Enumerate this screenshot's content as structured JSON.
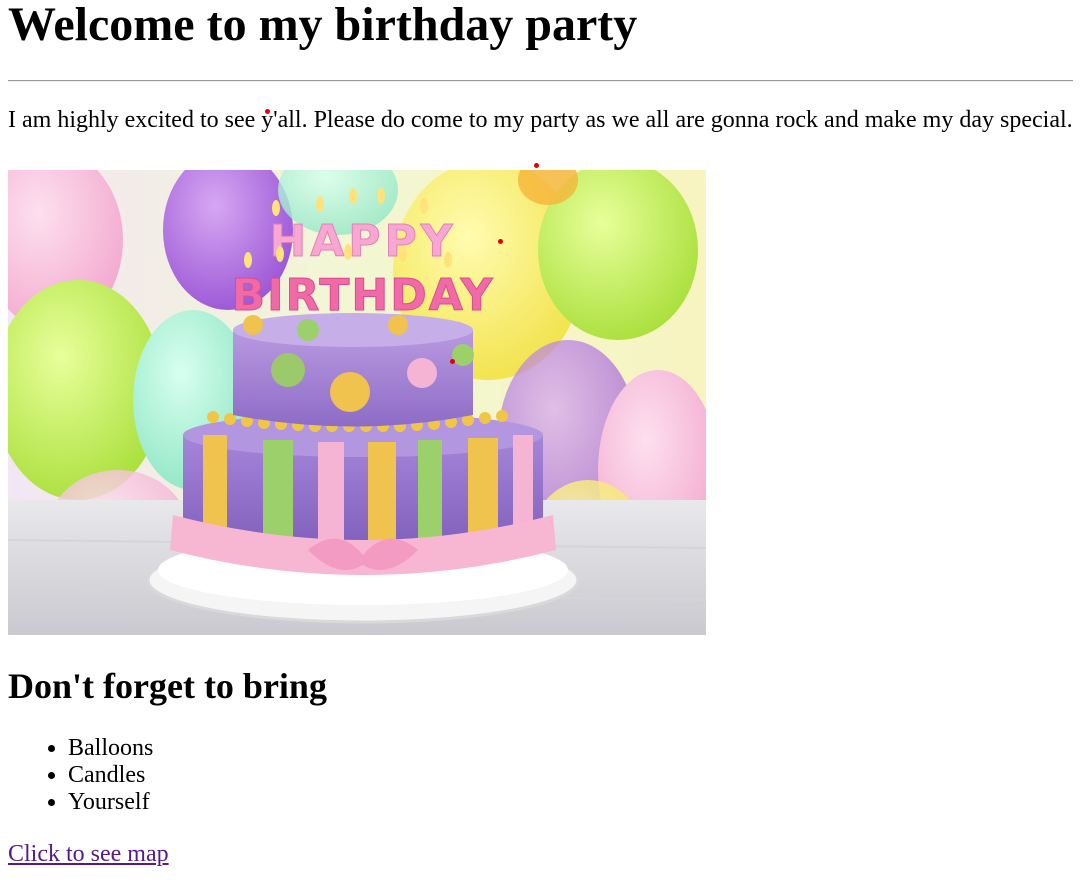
{
  "page": {
    "title": "Welcome to my birthday party",
    "intro": "I am highly excited to see y'all. Please do come to my party as we all are gonna rock and make my day special.",
    "image": {
      "description_icon": "birthday-cake-image",
      "topper_line1": "HAPPY",
      "topper_line2": "BIRTHDAY"
    },
    "bring_heading": "Don't forget to bring",
    "bring_items": [
      "Balloons",
      "Candles",
      "Yourself"
    ],
    "map_link": "Click to see map"
  },
  "colors": {
    "link_visited": "#551a8b",
    "marker_red": "#e00000"
  }
}
